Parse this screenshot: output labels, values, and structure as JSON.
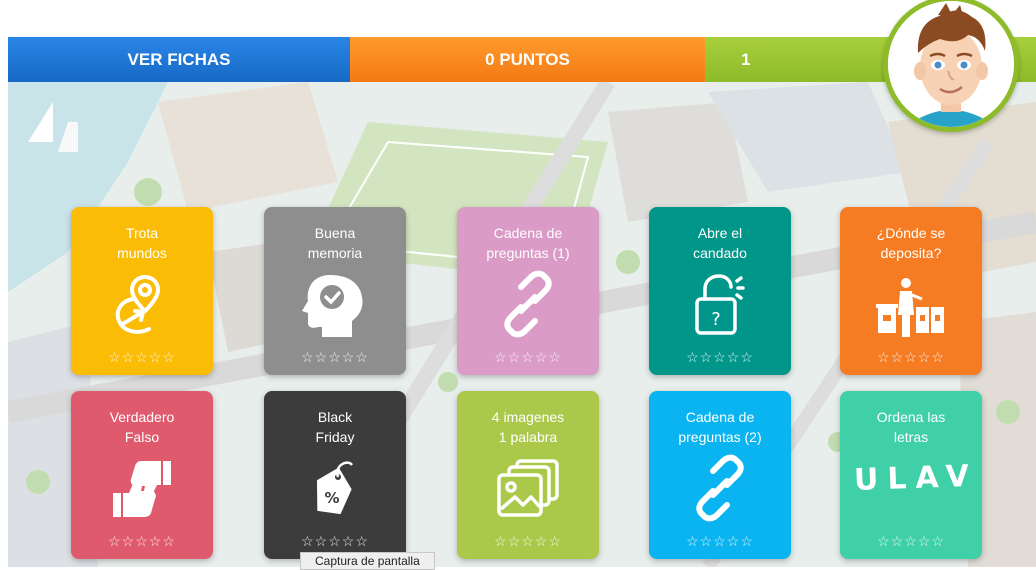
{
  "topbar": {
    "fichas_label": "VER FICHAS",
    "puntos_label": "0 PUNTOS",
    "level_value": "1"
  },
  "cards": [
    {
      "line1": "Trota",
      "line2": "mundos",
      "icon": "globe-pin-icon",
      "color": "#fbbc05",
      "stars": "☆☆☆☆☆"
    },
    {
      "line1": "Buena",
      "line2": "memoria",
      "icon": "head-check-icon",
      "color": "#8e8e8e",
      "stars": "☆☆☆☆☆"
    },
    {
      "line1": "Cadena de",
      "line2": "preguntas (1)",
      "icon": "chain-link-icon",
      "color": "#da9bc6",
      "stars": "☆☆☆☆☆"
    },
    {
      "line1": "Abre el",
      "line2": "candado",
      "icon": "padlock-question-icon",
      "color": "#00968a",
      "stars": "☆☆☆☆☆"
    },
    {
      "line1": "¿Dónde se",
      "line2": "deposita?",
      "icon": "recycling-bins-icon",
      "color": "#f57c22",
      "stars": "☆☆☆☆☆"
    },
    {
      "line1": "Verdadero",
      "line2": "Falso",
      "icon": "thumbs-up-down-icon",
      "color": "#e05a6e",
      "stars": "☆☆☆☆☆"
    },
    {
      "line1": "Black",
      "line2": "Friday",
      "icon": "price-tag-icon",
      "color": "#3c3c3c",
      "stars": "☆☆☆☆☆"
    },
    {
      "line1": "4 imagenes",
      "line2": "1 palabra",
      "icon": "images-stack-icon",
      "color": "#aac94a",
      "stars": "☆☆☆☆☆"
    },
    {
      "line1": "Cadena de",
      "line2": "preguntas (2)",
      "icon": "chain-link-icon",
      "color": "#0ab4f0",
      "stars": "☆☆☆☆☆"
    },
    {
      "line1": "Ordena las",
      "line2": "letras",
      "icon": "scrambled-letters-icon",
      "color": "#3fd0a8",
      "stars": "☆☆☆☆☆",
      "letters": "ULAV"
    }
  ],
  "tooltip": "Captura de pantalla"
}
